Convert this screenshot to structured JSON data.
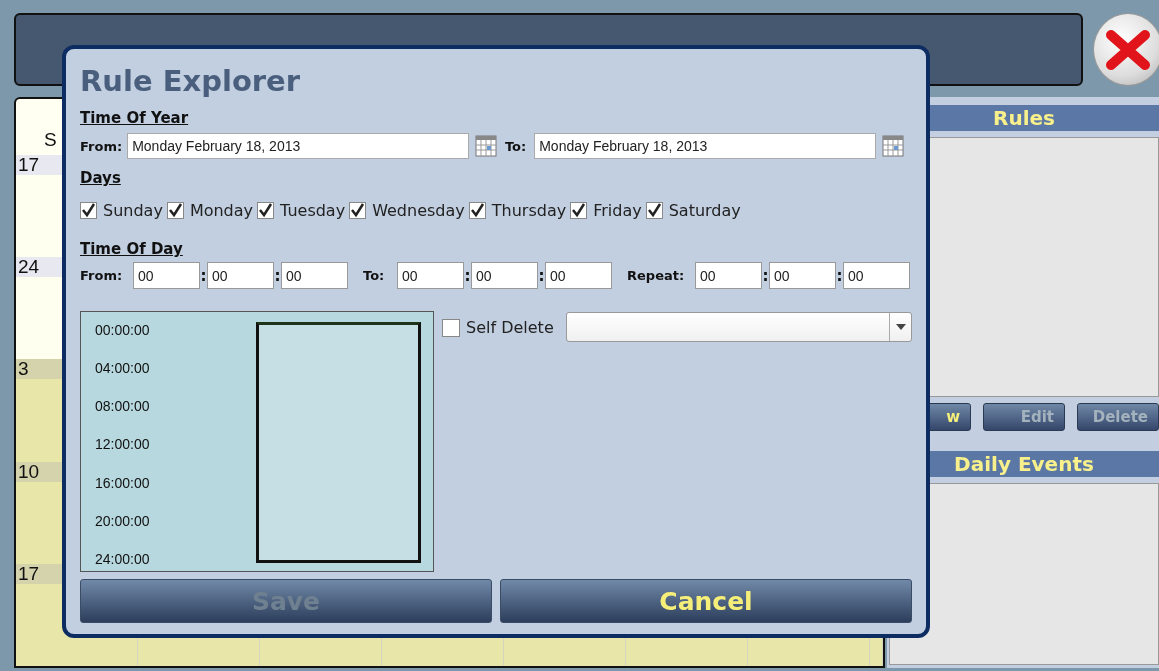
{
  "calendar": {
    "header": "S",
    "weeks": [
      {
        "label": "17",
        "shaded": false
      },
      {
        "label": "24",
        "shaded": false
      },
      {
        "label": "3",
        "shaded": true
      },
      {
        "label": "10",
        "shaded": true
      },
      {
        "label": "17",
        "shaded": true
      }
    ]
  },
  "rules_panel": {
    "title": "Rules",
    "buttons": [
      {
        "label": "w",
        "disabled": false
      },
      {
        "label": "Edit",
        "disabled": true
      },
      {
        "label": "Delete",
        "disabled": true
      }
    ]
  },
  "daily_events": {
    "title": "Daily Events"
  },
  "dialog": {
    "title": "Rule Explorer",
    "time_of_year": {
      "heading": "Time Of Year",
      "from_label": "From:",
      "from_value": "Monday February 18, 2013",
      "to_label": "To:",
      "to_value": "Monday February 18, 2013"
    },
    "days": {
      "heading": "Days",
      "items": [
        {
          "label": "Sunday",
          "checked": true
        },
        {
          "label": "Monday",
          "checked": true
        },
        {
          "label": "Tuesday",
          "checked": true
        },
        {
          "label": "Wednesday",
          "checked": true
        },
        {
          "label": "Thursday",
          "checked": true
        },
        {
          "label": "Friday",
          "checked": true
        },
        {
          "label": "Saturday",
          "checked": true
        }
      ]
    },
    "time_of_day": {
      "heading": "Time Of Day",
      "separator": ":",
      "groups": [
        {
          "label": "From:",
          "values": [
            "00",
            "00",
            "00"
          ]
        },
        {
          "label": "To:",
          "values": [
            "00",
            "00",
            "00"
          ]
        },
        {
          "label": "Repeat:",
          "values": [
            "00",
            "00",
            "00"
          ]
        }
      ]
    },
    "timeline": {
      "times": [
        "00:00:00",
        "04:00:00",
        "08:00:00",
        "12:00:00",
        "16:00:00",
        "20:00:00",
        "24:00:00"
      ]
    },
    "self_delete": {
      "label": "Self Delete",
      "checked": false
    },
    "buttons": [
      {
        "label": "Save",
        "disabled": true
      },
      {
        "label": "Cancel",
        "disabled": false
      }
    ]
  }
}
